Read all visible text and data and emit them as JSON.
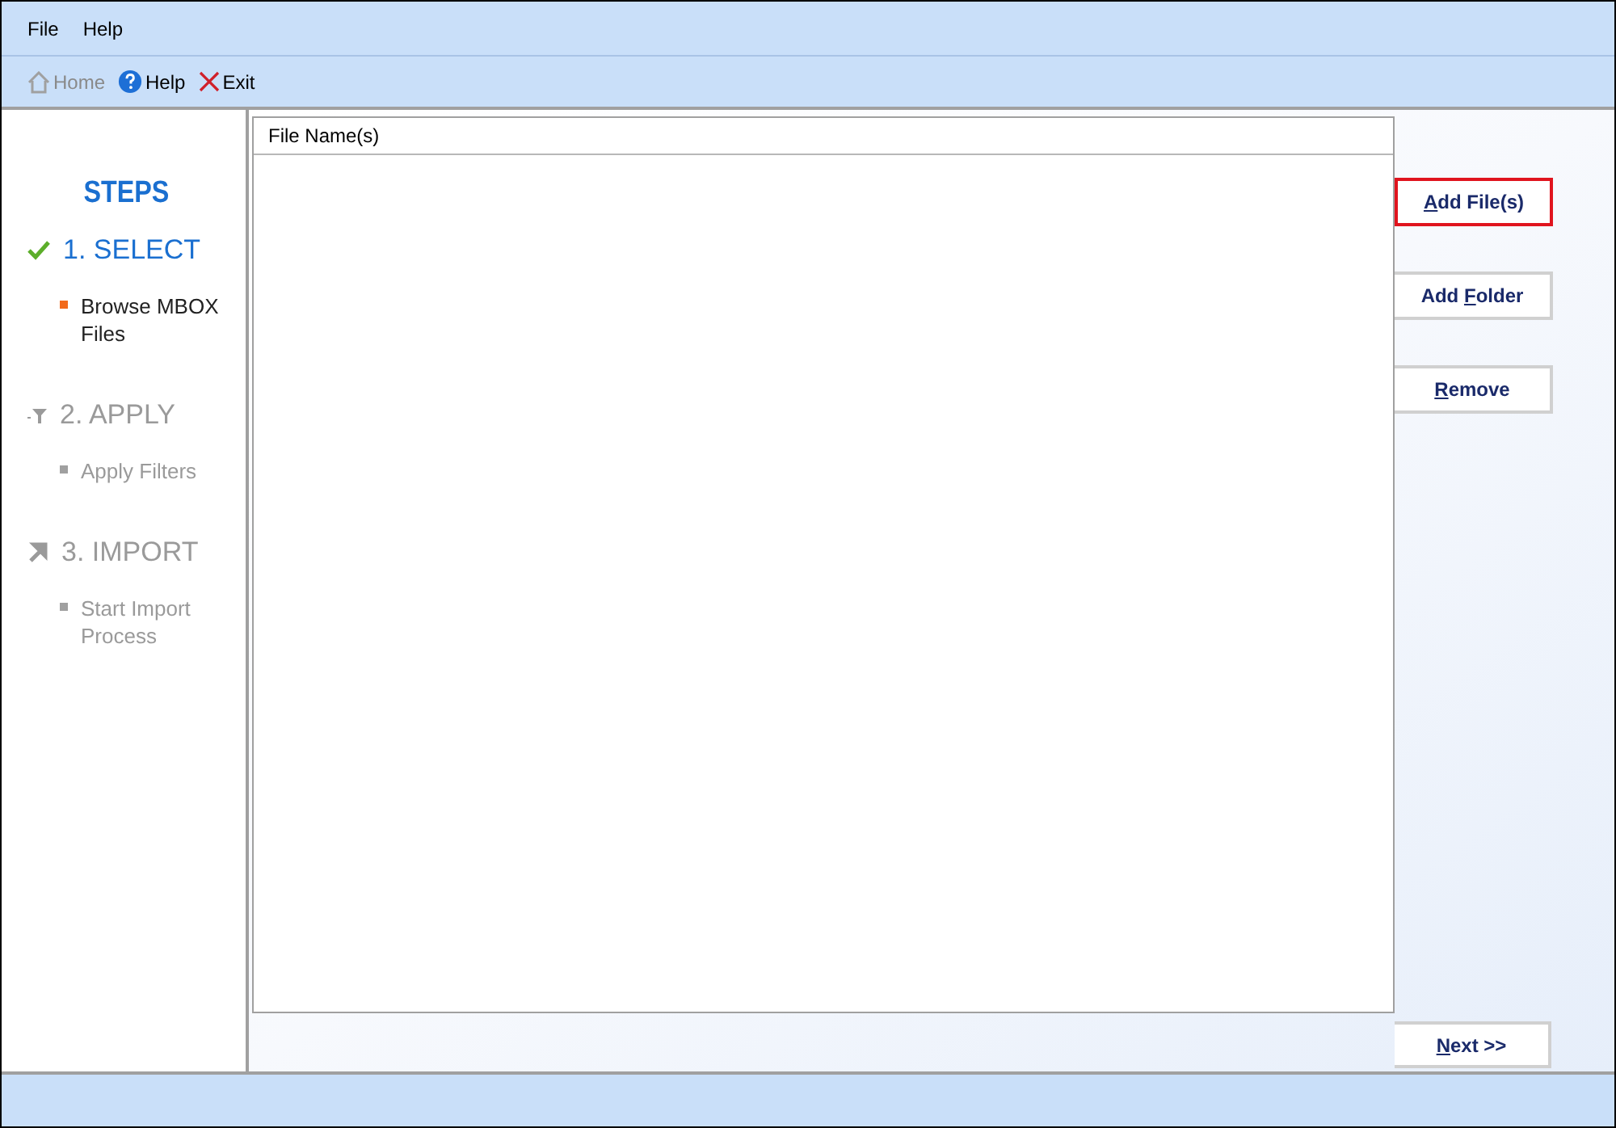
{
  "menu": [
    "File",
    "Help"
  ],
  "toolbar": [
    {
      "kind": "home",
      "label": "Home",
      "disabled": true
    },
    {
      "kind": "help",
      "label": "Help",
      "disabled": false
    },
    {
      "kind": "exit",
      "label": "Exit",
      "disabled": false
    }
  ],
  "steps": {
    "title": "STEPS",
    "items": [
      {
        "kind": "check",
        "label": "1. SELECT",
        "selected": true,
        "sub": [
          "Browse MBOX",
          "Files"
        ]
      },
      {
        "kind": "filter",
        "label": "2. APPLY",
        "selected": false,
        "sub": [
          "Apply Filters"
        ]
      },
      {
        "kind": "arrow",
        "label": "3. IMPORT",
        "selected": false,
        "sub": [
          "Start Import",
          "Process"
        ]
      }
    ]
  },
  "table": {
    "columns": [
      "File Name(s)"
    ]
  },
  "buttons": [
    {
      "parts": {
        "key": "A",
        "after": "dd File(s)"
      },
      "highlighted": true
    },
    {
      "parts": {
        "before": "Add ",
        "key": "F",
        "after": "older"
      },
      "highlighted": false
    },
    {
      "parts": {
        "key": "R",
        "after": "emove"
      },
      "highlighted": false
    }
  ],
  "next": {
    "parts": {
      "key": "N",
      "after": "ext >>"
    }
  }
}
